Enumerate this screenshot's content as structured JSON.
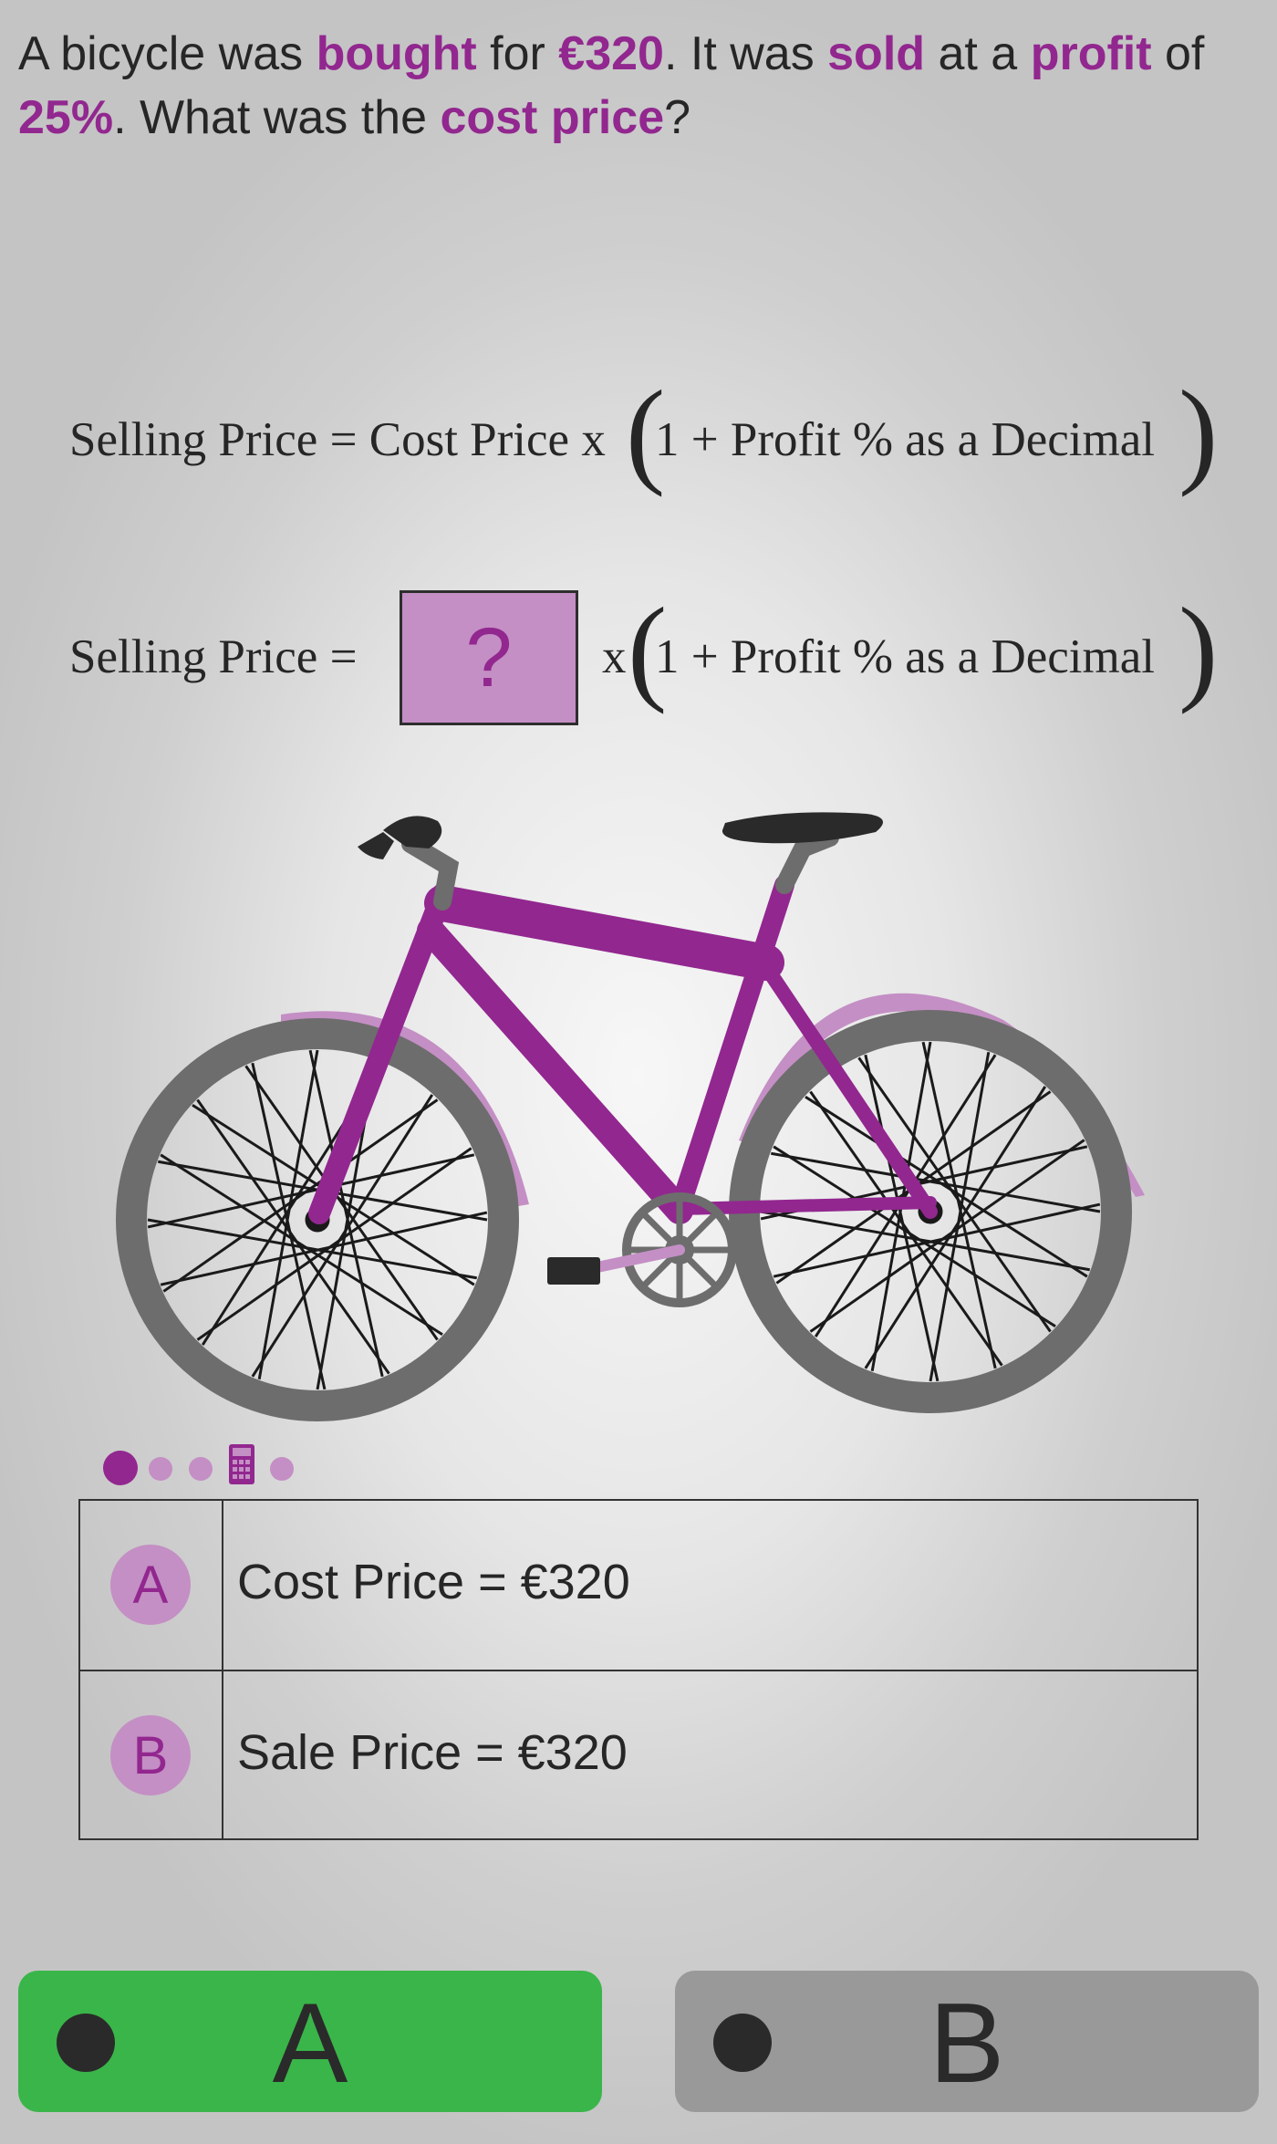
{
  "question": {
    "parts": [
      {
        "text": "A bicycle was ",
        "hl": false
      },
      {
        "text": "bought",
        "hl": true
      },
      {
        "text": " for ",
        "hl": false
      },
      {
        "text": "€320",
        "hl": true
      },
      {
        "text": ". It was ",
        "hl": false
      },
      {
        "text": "sold",
        "hl": true
      },
      {
        "text": " at a ",
        "hl": false
      },
      {
        "text": "profit",
        "hl": true
      },
      {
        "text": " of ",
        "hl": false
      },
      {
        "text": "25%",
        "hl": true
      },
      {
        "text": ". What was the ",
        "hl": false
      },
      {
        "text": "cost price",
        "hl": true
      },
      {
        "text": "?",
        "hl": false
      }
    ]
  },
  "formula1": {
    "lhs": "Selling Price = Cost Price x",
    "open_paren": "(",
    "inner": "1 + Profit % as a Decimal",
    "close_paren": ")"
  },
  "formula2": {
    "lhs": "Selling Price =",
    "unknown": "?",
    "times": "x",
    "open_paren": "(",
    "inner": "1 + Profit % as a Decimal",
    "close_paren": ")"
  },
  "options": [
    {
      "letter": "A",
      "text": "Cost Price = €320"
    },
    {
      "letter": "B",
      "text": "Sale Price = €320"
    }
  ],
  "answers": [
    {
      "label": "A",
      "color": "#3ab54a"
    },
    {
      "label": "B",
      "color": "#999999"
    }
  ],
  "colors": {
    "accent": "#92278f",
    "accent_light": "#c48fc4",
    "correct": "#3ab54a",
    "neutral": "#999999"
  },
  "pager": {
    "icons": [
      "dot-active",
      "dot",
      "dot",
      "calculator-icon",
      "dot"
    ]
  }
}
